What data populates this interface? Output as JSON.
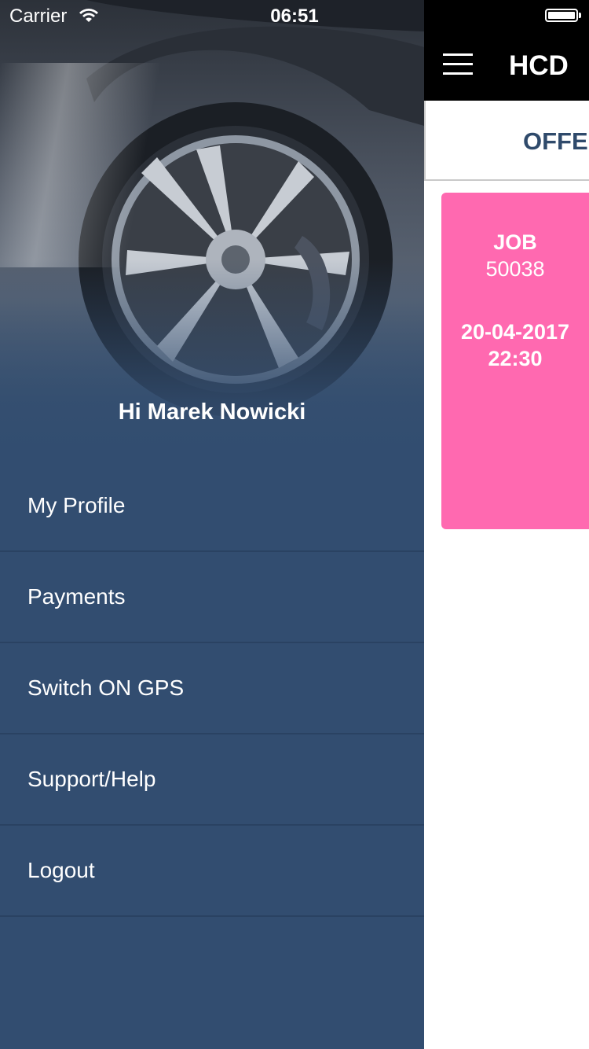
{
  "status_bar": {
    "carrier": "Carrier",
    "time": "06:51"
  },
  "drawer": {
    "greeting": "Hi Marek Nowicki",
    "menu_items": [
      {
        "label": "My Profile"
      },
      {
        "label": "Payments"
      },
      {
        "label": "Switch ON GPS"
      },
      {
        "label": "Support/Help"
      },
      {
        "label": "Logout"
      }
    ]
  },
  "main": {
    "nav_title": "HCD",
    "tab_label": "OFFER",
    "job_card": {
      "label": "JOB",
      "number": "50038",
      "date": "20-04-2017",
      "time": "22:30"
    }
  },
  "colors": {
    "drawer_bg": "#324d70",
    "card_pink": "#ff69b0",
    "tab_text": "#2f4a6b"
  },
  "icons": [
    "wifi-icon",
    "battery-icon",
    "hamburger-menu-icon"
  ]
}
